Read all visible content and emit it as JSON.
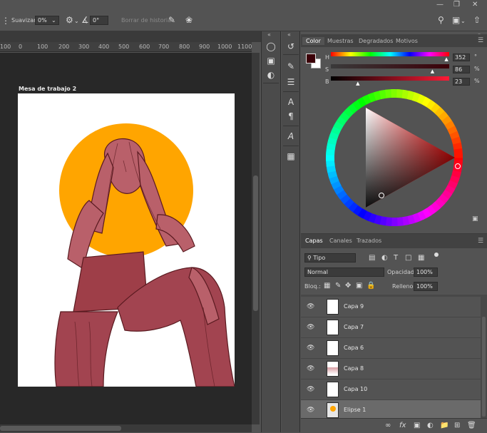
{
  "title_bar": {
    "minimize_icon": "minimize-icon",
    "restore_icon": "restore-icon",
    "close_icon": "close-icon"
  },
  "options_bar": {
    "smoothing_label": "Suavizar:",
    "smoothing_value": "0%",
    "angle_value": "0°",
    "erase_history_label": "Borrar de historia"
  },
  "ruler": {
    "ticks": [
      "100",
      "0",
      "100",
      "200",
      "300",
      "400",
      "500",
      "600",
      "700",
      "800",
      "900",
      "1000",
      "1100"
    ]
  },
  "canvas": {
    "artboard_label": "Mesa de trabajo 2",
    "circle_color": "#ffa500",
    "figure_tint": "#b2505a"
  },
  "color_panel": {
    "tabs": [
      "Color",
      "Muestras",
      "Degradados",
      "Motivos"
    ],
    "active_tab": "Color",
    "h_label": "H",
    "h_value": "352",
    "h_unit": "°",
    "s_label": "S",
    "s_value": "86",
    "s_unit": "%",
    "b_label": "B",
    "b_value": "23",
    "b_unit": "%",
    "foreground_color": "#3b0008",
    "background_color": "#ffffff",
    "hue_fraction": 0.978,
    "saturation_fraction": 0.86,
    "brightness_fraction": 0.23
  },
  "layers_panel": {
    "tabs": [
      "Capas",
      "Canales",
      "Trazados"
    ],
    "active_tab": "Capas",
    "filter_kind": "Tipo",
    "blend_mode": "Normal",
    "opacity_label": "Opacidad:",
    "opacity_value": "100%",
    "lock_label": "Bloq.:",
    "fill_label": "Relleno:",
    "fill_value": "100%",
    "layers": [
      {
        "name": "Capa 9",
        "selected": false
      },
      {
        "name": "Capa 7",
        "selected": false
      },
      {
        "name": "Capa 6",
        "selected": false
      },
      {
        "name": "Capa 8",
        "selected": false
      },
      {
        "name": "Capa 10",
        "selected": false
      },
      {
        "name": "Elipse 1",
        "selected": true
      }
    ],
    "bottom_icons": [
      "link-icon",
      "fx-icon",
      "mask-icon",
      "adjustment-icon",
      "group-folder-icon",
      "new-layer-icon",
      "trash-icon"
    ]
  }
}
